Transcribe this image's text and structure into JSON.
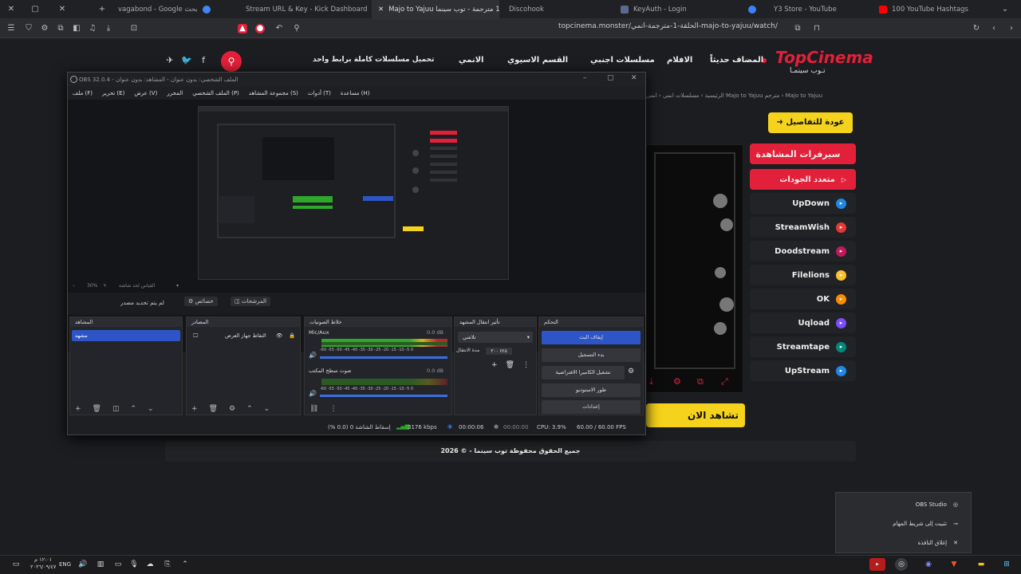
{
  "browser": {
    "tabs": [
      {
        "label": "vagabond - Google بحث",
        "icon": "google-icon",
        "color": "#4285f4"
      },
      {
        "label": "Stream URL & Key - Kick Dashboard",
        "icon": "kick-icon",
        "color": "#53fc18"
      },
      {
        "label": "Majo to Yajuu الحلقة 1 مترجمة - توب سينما",
        "icon": "topcinema-icon",
        "color": "#e3203a"
      },
      {
        "label": "Discohook",
        "icon": "discohook-icon",
        "color": "#5865f2"
      },
      {
        "label": "KeyAuth - Login",
        "icon": "keyauth-icon",
        "color": "#3b82f6"
      },
      {
        "label": "Y3 Store - YouTube",
        "icon": "youtube-icon",
        "color": "#ff0000"
      },
      {
        "label": "100 YouTube Hashtags",
        "icon": "youtube-icon",
        "color": "#ff0000"
      }
    ],
    "url": "topcinema.monster/الحلقة-1-مترجمة-انمي-majo-to-yajuu/watch/"
  },
  "site": {
    "logo": "TopCinema",
    "logo_ar": "تـوب سينمـا",
    "nav": [
      "المضاف حديثاً",
      "الافلام",
      "مسلسلات اجنبي",
      "القسم الاسيوي",
      "الانمي",
      "تحميل مسلسلات كاملة برابط واحد"
    ],
    "breadcrumbs": "الرئيسية › مسلسلات انمي › انمي Majo to Yajuu مترجم › Majo to Yajuu",
    "back_label": "عودة للتفاصيل",
    "servers_title": "سيرفرات المشاهدة",
    "multi_quality": "متعدد الجودات",
    "servers": [
      {
        "name": "UpDown",
        "color": "#1e88e5"
      },
      {
        "name": "StreamWish",
        "color": "#e53935"
      },
      {
        "name": "Doodstream",
        "color": "#c2185b"
      },
      {
        "name": "Filelions",
        "color": "#fbc02d"
      },
      {
        "name": "OK",
        "color": "#fb8c00"
      },
      {
        "name": "Uqload",
        "color": "#7c4dff"
      },
      {
        "name": "Streamtape",
        "color": "#00897b"
      },
      {
        "name": "UpStream",
        "color": "#1e88e5"
      }
    ],
    "watch_now": "تشاهد الان",
    "footer": "جميع الحقوق محفوظة توب سينما - © 2026",
    "accent": "#e3203a",
    "yellow": "#f5d21b"
  },
  "obs": {
    "title": "OBS 32.0.4 - الملف الشخصي: بدون عنوان - المشاهد: بدون عنوان",
    "menu": [
      "ملف (F)",
      "تحرير (E)",
      "عرض (V)",
      "المحرر",
      "الملف الشخصي (P)",
      "مجموعة المشاهد (S)",
      "أدوات (T)",
      "مساعدة (H)"
    ],
    "zoom": "30%",
    "zoom_label": "القياس لحد شاشة",
    "no_source": "لم يتم تحديد مصدر",
    "props_btn": "خصائص",
    "filters_btn": "المرشحات",
    "docks": {
      "scenes": "المشاهد",
      "sources": "المصادر",
      "mixer": "خلاط الصوتيات",
      "transitions": "تأثير انتقال المشهد",
      "controls": "التحكم"
    },
    "scene_item": "مشهد",
    "source_item": "التقاط جهاز العرض",
    "mic_label": "Mic/Aux",
    "mic_db": "0.0 dB",
    "desktop_label": "صوت سطح المكتب",
    "desktop_db": "0.0 dB",
    "meter_ticks": "-60 -55 -50 -45 -40 -35 -30 -25 -20 -15 -10 -5 0",
    "transition": "تلاشي",
    "duration_label": "مدة الانتقال",
    "duration": "٣٠٠ ms",
    "controls": [
      "إيقاف البث",
      "بدء التسجيل",
      "تشغيل الكاميرا الافتراضية",
      "طور الاستوديو",
      "إعدادات"
    ],
    "status": {
      "dropped": "إسقاط الشاشة 0 (0.0 %)",
      "kbps": "3176 kbps",
      "stream_time": "00:00:06",
      "rec_time": "00:00:00",
      "cpu": "CPU: 3.9%",
      "fps": "60.00 / 60.00 FPS"
    }
  },
  "popup": {
    "app": "OBS Studio",
    "pin": "تثبيت إلى شريط المهام",
    "close": "إغلاق النافذة"
  },
  "taskbar": {
    "lang": "ENG",
    "time": "١٢:٠١ م",
    "date": "٢٠٢٦/٠٩/٤٧"
  }
}
